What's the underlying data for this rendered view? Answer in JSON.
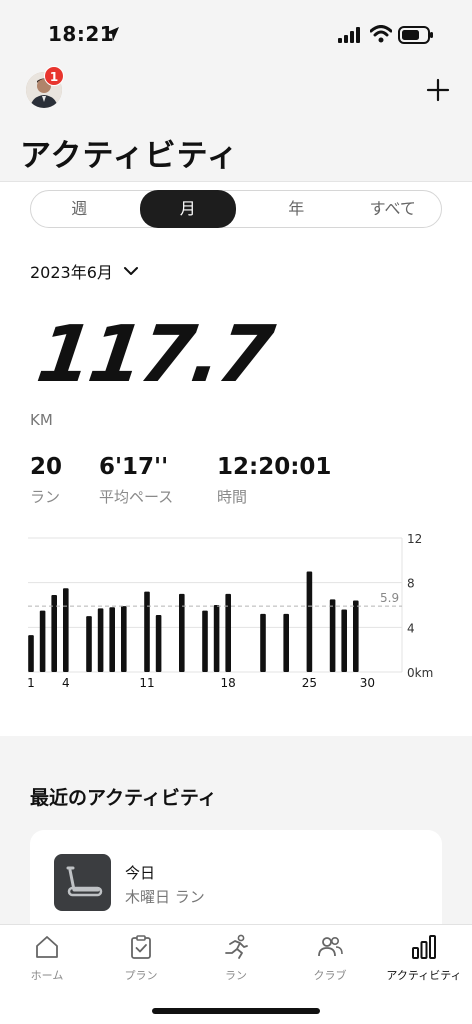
{
  "status_bar": {
    "time": "18:21",
    "icons": [
      "location-arrow-icon",
      "signal-icon",
      "wifi-icon",
      "battery-icon"
    ]
  },
  "header": {
    "title": "アクティビティ",
    "avatar_badge": "1",
    "plus_icon": "plus-icon"
  },
  "period_tabs": [
    "週",
    "月",
    "年",
    "すべて"
  ],
  "selected_period": "月",
  "date_selector": "2023年6月",
  "summary": {
    "distance": "117.7",
    "unit": "KM",
    "stats": [
      {
        "value": "20",
        "label": "ラン"
      },
      {
        "value": "6'17''",
        "label": "平均ペース"
      },
      {
        "value": "12:20:01",
        "label": "時間"
      }
    ]
  },
  "chart_data": {
    "type": "bar",
    "x_tick_labels": [
      "1",
      "4",
      "11",
      "18",
      "25",
      "30"
    ],
    "x_ticks_at": [
      1,
      4,
      11,
      18,
      25,
      30
    ],
    "y_tick_labels": [
      "0km",
      "4",
      "8",
      "12"
    ],
    "y_ticks": [
      0,
      4,
      8,
      12
    ],
    "ylim": [
      0,
      12
    ],
    "average": 5.9,
    "average_label": "5.9",
    "x": [
      1,
      2,
      3,
      4,
      6,
      7,
      8,
      9,
      11,
      12,
      14,
      16,
      17,
      18,
      21,
      23,
      25,
      27,
      28,
      29
    ],
    "values": [
      3.3,
      5.5,
      6.9,
      7.5,
      5.0,
      5.7,
      5.8,
      5.9,
      7.2,
      5.1,
      7.0,
      5.5,
      6.0,
      7.0,
      5.2,
      5.2,
      9.0,
      6.5,
      5.6,
      6.4
    ]
  },
  "recent": {
    "title": "最近のアクティビティ",
    "card": {
      "day": "今日",
      "sub": "木曜日 ラン"
    }
  },
  "tab_bar": [
    {
      "label": "ホーム",
      "icon": "home-icon"
    },
    {
      "label": "プラン",
      "icon": "clipboard-check-icon"
    },
    {
      "label": "ラン",
      "icon": "runner-icon"
    },
    {
      "label": "クラブ",
      "icon": "people-icon"
    },
    {
      "label": "アクティビティ",
      "icon": "bar-chart-icon"
    }
  ],
  "active_tab": "アクティビティ"
}
